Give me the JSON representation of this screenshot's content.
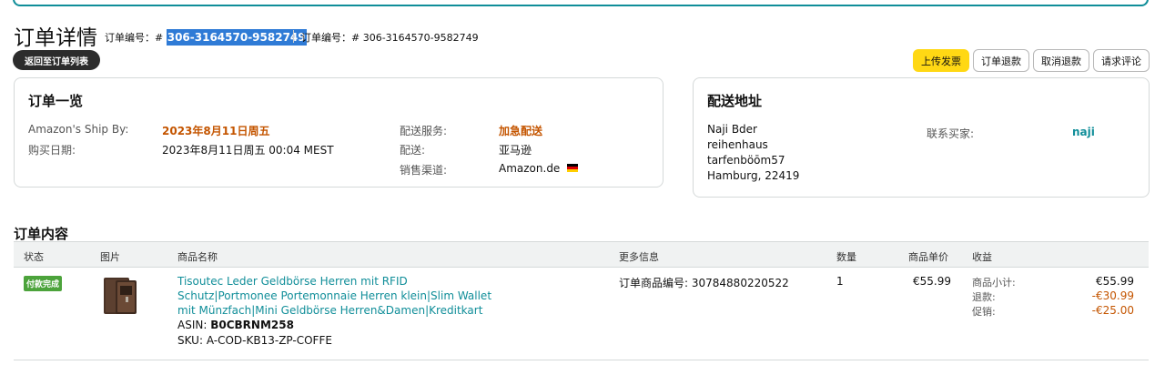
{
  "page_title": "订单详情",
  "order_number_label": "订单编号：#",
  "order_number": "306-3164570-9582749",
  "order_number_label_2": "订单编号：#",
  "order_number_2": "306-3164570-9582749",
  "back_button": "返回至订单列表",
  "actions": {
    "upload_invoice": "上传发票",
    "refund": "订单退款",
    "cancel_refund": "取消退款",
    "request_review": "请求评论"
  },
  "overview": {
    "title": "订单一览",
    "ship_by_label": "Amazon's Ship By:",
    "ship_by_value": "2023年8月11日周五",
    "purchase_date_label": "购买日期:",
    "purchase_date_value": "2023年8月11日周五 00:04 MEST",
    "shipping_service_label": "配送服务:",
    "shipping_service_value": "加急配送",
    "fulfillment_label": "配送:",
    "fulfillment_value": "亚马逊",
    "channel_label": "销售渠道:",
    "channel_value": "Amazon.de"
  },
  "shipping": {
    "title": "配送地址",
    "address_lines": [
      "Naji Bder",
      "reihenhaus",
      "tarfenböōm57",
      "Hamburg, 22419"
    ],
    "contact_label": "联系买家:",
    "contact_name": "naji"
  },
  "contents": {
    "title": "订单内容",
    "headers": {
      "status": "状态",
      "image": "图片",
      "product_name": "商品名称",
      "more_info": "更多信息",
      "quantity": "数量",
      "unit_price": "商品单价",
      "income": "收益"
    },
    "item": {
      "status_badge": "付款完成",
      "product_title": "Tisoutec Leder Geldbörse Herren mit RFID Schutz|Portmonee Portemonnaie Herren klein|Slim Wallet mit Münzfach|Mini Geldbörse Herren&Damen|Kreditkart",
      "asin_label": "ASIN:",
      "asin": "B0CBRNM258",
      "sku_label": "SKU:",
      "sku": "A-COD-KB13-ZP-COFFE",
      "order_item_id_label": "订单商品编号:",
      "order_item_id": "30784880220522",
      "quantity": "1",
      "unit_price": "€55.99",
      "income": {
        "subtotal_label": "商品小计:",
        "subtotal_value": "€55.99",
        "refund_label": "退款:",
        "refund_value": "-€30.99",
        "promo_label": "促销:",
        "promo_value": "-€25.00"
      }
    }
  },
  "colors": {
    "accent_teal": "#108e99",
    "accent_orange": "#c45500",
    "button_yellow": "#ffd814",
    "badge_green": "#4ca33b",
    "highlight_blue": "#2f7bd6"
  }
}
